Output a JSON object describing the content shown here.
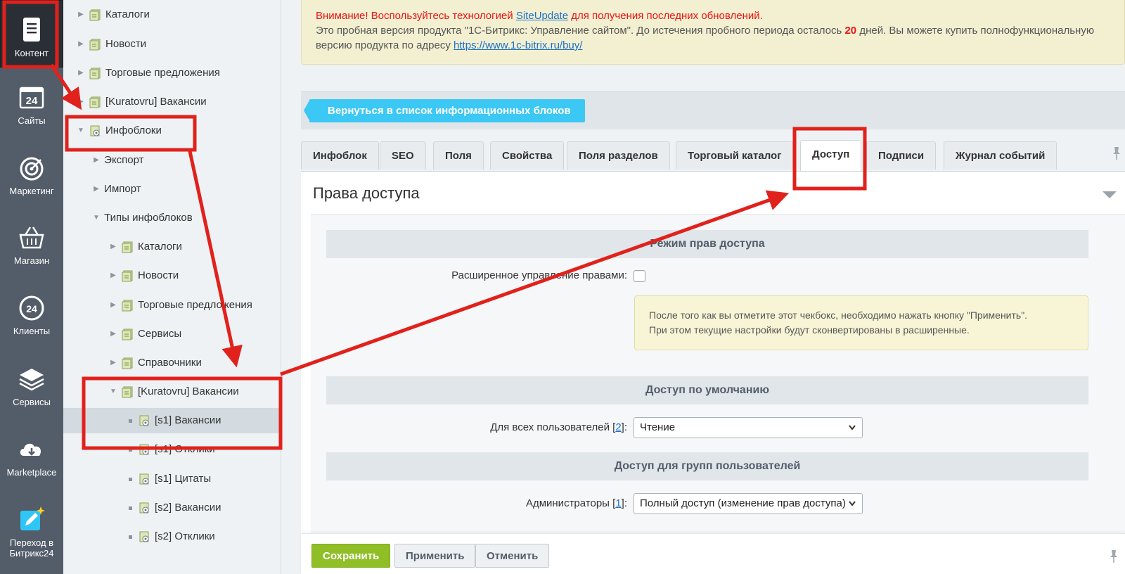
{
  "rail": {
    "items": [
      {
        "label": "Контент",
        "icon": "document-icon",
        "active": true
      },
      {
        "label": "Сайты",
        "icon": "calendar-24-icon"
      },
      {
        "label": "Маркетинг",
        "icon": "target-icon"
      },
      {
        "label": "Магазин",
        "icon": "basket-icon"
      },
      {
        "label": "Клиенты",
        "icon": "crm-24-icon"
      },
      {
        "label": "Сервисы",
        "icon": "layers-icon"
      },
      {
        "label": "Marketplace",
        "icon": "cloud-download-icon"
      },
      {
        "label": "Переход в Битрикс24",
        "icon": "edit-star-icon"
      }
    ]
  },
  "tree": {
    "nodes": [
      {
        "label": "Каталоги"
      },
      {
        "label": "Новости"
      },
      {
        "label": "Торговые предложения"
      },
      {
        "label": "[Kuratovru] Вакансии"
      },
      {
        "label": "Инфоблоки"
      },
      {
        "label": "Экспорт"
      },
      {
        "label": "Импорт"
      },
      {
        "label": "Типы инфоблоков"
      },
      {
        "label": "Каталоги"
      },
      {
        "label": "Новости"
      },
      {
        "label": "Торговые предложения"
      },
      {
        "label": "Сервисы"
      },
      {
        "label": "Справочники"
      },
      {
        "label": "[Kuratovru] Вакансии"
      },
      {
        "label": "[s1] Вакансии"
      },
      {
        "label": "[s1] Отклики"
      },
      {
        "label": "[s1] Цитаты"
      },
      {
        "label": "[s2] Вакансии"
      },
      {
        "label": "[s2] Отклики"
      }
    ]
  },
  "notice": {
    "warn_prefix": "Внимание! Воспользуйтесь технологией",
    "link_siteupdate": "SiteUpdate",
    "warn_suffix": "для получения последних обновлений.",
    "line2_prefix": "Это пробная версия продукта \"1С-Битрикс: Управление сайтом\". До истечения пробного периода осталось",
    "days": "20",
    "line2_suffix": "дней. Вы можете купить полнофункциональную",
    "line3_prefix": "версию продукта по адресу",
    "buy_link": "https://www.1c-bitrix.ru/buy/"
  },
  "back_button": "Вернуться в список информационных блоков",
  "tabs": [
    {
      "label": "Инфоблок"
    },
    {
      "label": "SEO"
    },
    {
      "label": "Поля"
    },
    {
      "label": "Свойства"
    },
    {
      "label": "Поля разделов"
    },
    {
      "label": "Торговый каталог"
    },
    {
      "label": "Доступ",
      "active": true
    },
    {
      "label": "Подписи"
    },
    {
      "label": "Журнал событий"
    }
  ],
  "card": {
    "title": "Права доступа",
    "section_mode": "Режим прав доступа",
    "extended_label": "Расширенное управление правами:",
    "hint_line1": "После того как вы отметите этот чекбокс, необходимо нажать кнопку \"Применить\".",
    "hint_line2": "При этом текущие настройки будут сконвертированы в расширенные.",
    "section_default": "Доступ по умолчанию",
    "all_users_label": "Для всех пользователей",
    "all_users_ref": "2",
    "all_users_value": "Чтение",
    "section_groups": "Доступ для групп пользователей",
    "admins_label": "Администраторы",
    "admins_ref": "1",
    "admins_value": "Полный доступ (изменение прав доступа)"
  },
  "footer": {
    "save": "Сохранить",
    "apply": "Применить",
    "cancel": "Отменить"
  },
  "colors": {
    "rail_bg": "#535c69",
    "accent_blue": "#3bc8f5",
    "save_green": "#8fbe27",
    "annotation_red": "#e1211c"
  }
}
